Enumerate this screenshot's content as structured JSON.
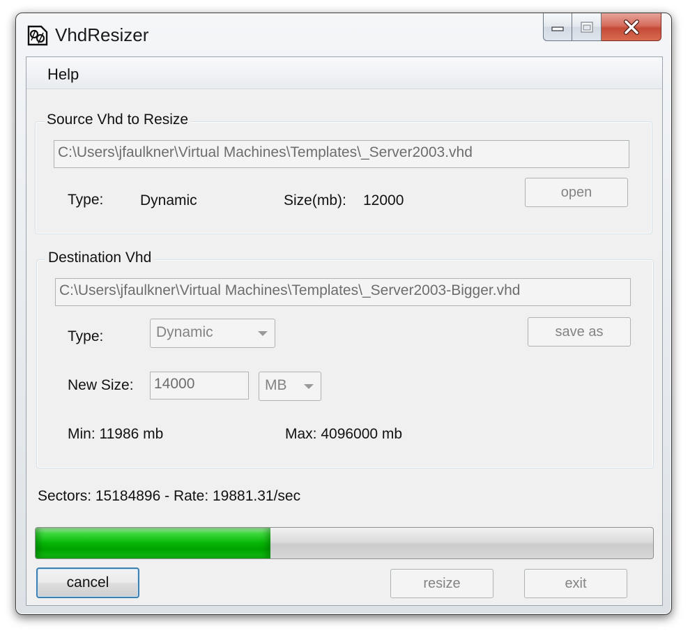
{
  "window": {
    "title": "VhdResizer",
    "icon": "vhdresizer-app-icon",
    "controls": [
      "minimize-icon",
      "maximize-icon",
      "close-icon"
    ]
  },
  "menu": {
    "help": "Help"
  },
  "source": {
    "group_label": "Source Vhd to Resize",
    "path": "C:\\Users\\jfaulkner\\Virtual Machines\\Templates\\_Server2003.vhd",
    "type_label": "Type:",
    "type_value": "Dynamic",
    "size_label": "Size(mb):",
    "size_value": "12000",
    "open_label": "open"
  },
  "destination": {
    "group_label": "Destination Vhd",
    "path": "C:\\Users\\jfaulkner\\Virtual Machines\\Templates\\_Server2003-Bigger.vhd",
    "type_label": "Type:",
    "type_value": "Dynamic",
    "save_as_label": "save as",
    "new_size_label": "New Size:",
    "new_size_value": "14000",
    "unit_value": "MB",
    "min_text": "Min: 11986 mb",
    "max_text": "Max: 4096000 mb"
  },
  "status": {
    "text": "Sectors: 15184896 - Rate: 19881.31/sec",
    "progress_fraction": 0.38,
    "progress_color": "#06b606"
  },
  "buttons": {
    "cancel": "cancel",
    "resize": "resize",
    "exit": "exit"
  },
  "colors": {
    "close_button": "#c44a36",
    "default_button_border": "#3c7fb1"
  }
}
